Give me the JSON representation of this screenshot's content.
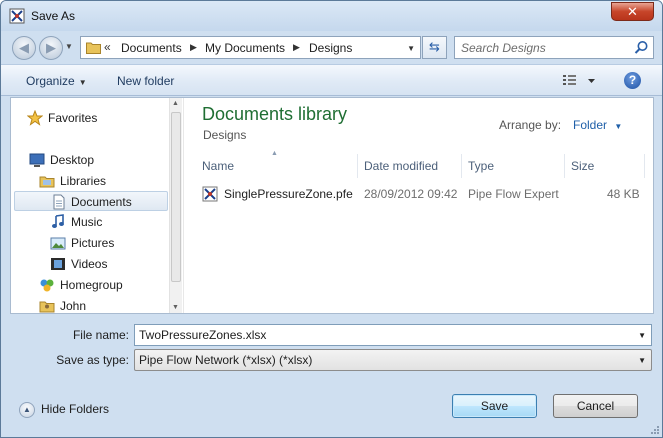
{
  "window": {
    "title": "Save As",
    "close_label": "✕"
  },
  "address": {
    "chevron": "«",
    "crumbs": [
      "Documents",
      "My Documents",
      "Designs"
    ],
    "separator": "▶"
  },
  "search": {
    "placeholder": "Search Designs",
    "value": ""
  },
  "toolbar": {
    "organize": "Organize",
    "new_folder": "New folder",
    "help": "?"
  },
  "nav": {
    "items": [
      {
        "label": "Favorites",
        "icon": "star-icon"
      },
      {
        "label": "Desktop",
        "icon": "desktop-icon"
      },
      {
        "label": "Libraries",
        "icon": "libraries-icon"
      },
      {
        "label": "Documents",
        "icon": "documents-icon"
      },
      {
        "label": "Music",
        "icon": "music-icon"
      },
      {
        "label": "Pictures",
        "icon": "pictures-icon"
      },
      {
        "label": "Videos",
        "icon": "videos-icon"
      },
      {
        "label": "Homegroup",
        "icon": "homegroup-icon"
      },
      {
        "label": "John",
        "icon": "user-folder-icon"
      }
    ],
    "selected": "Documents"
  },
  "content": {
    "library_title": "Documents library",
    "library_subtitle": "Designs",
    "arrange_label": "Arrange by:",
    "arrange_value": "Folder",
    "columns": [
      "Name",
      "Date modified",
      "Type",
      "Size"
    ],
    "files": [
      {
        "name": "SinglePressureZone.pfe",
        "date": "28/09/2012 09:42",
        "type": "Pipe Flow Expert",
        "size": "48 KB"
      }
    ]
  },
  "form": {
    "file_name_label": "File name:",
    "file_name_value": "TwoPressureZones.xlsx",
    "save_type_label": "Save as type:",
    "save_type_value": "Pipe Flow Network (*xlsx) (*xlsx)"
  },
  "footer": {
    "hide_folders": "Hide Folders",
    "save": "Save",
    "cancel": "Cancel"
  },
  "colors": {
    "library_title": "#1f6e33",
    "link_blue": "#1f5fa8",
    "close_red": "#c7452a"
  }
}
